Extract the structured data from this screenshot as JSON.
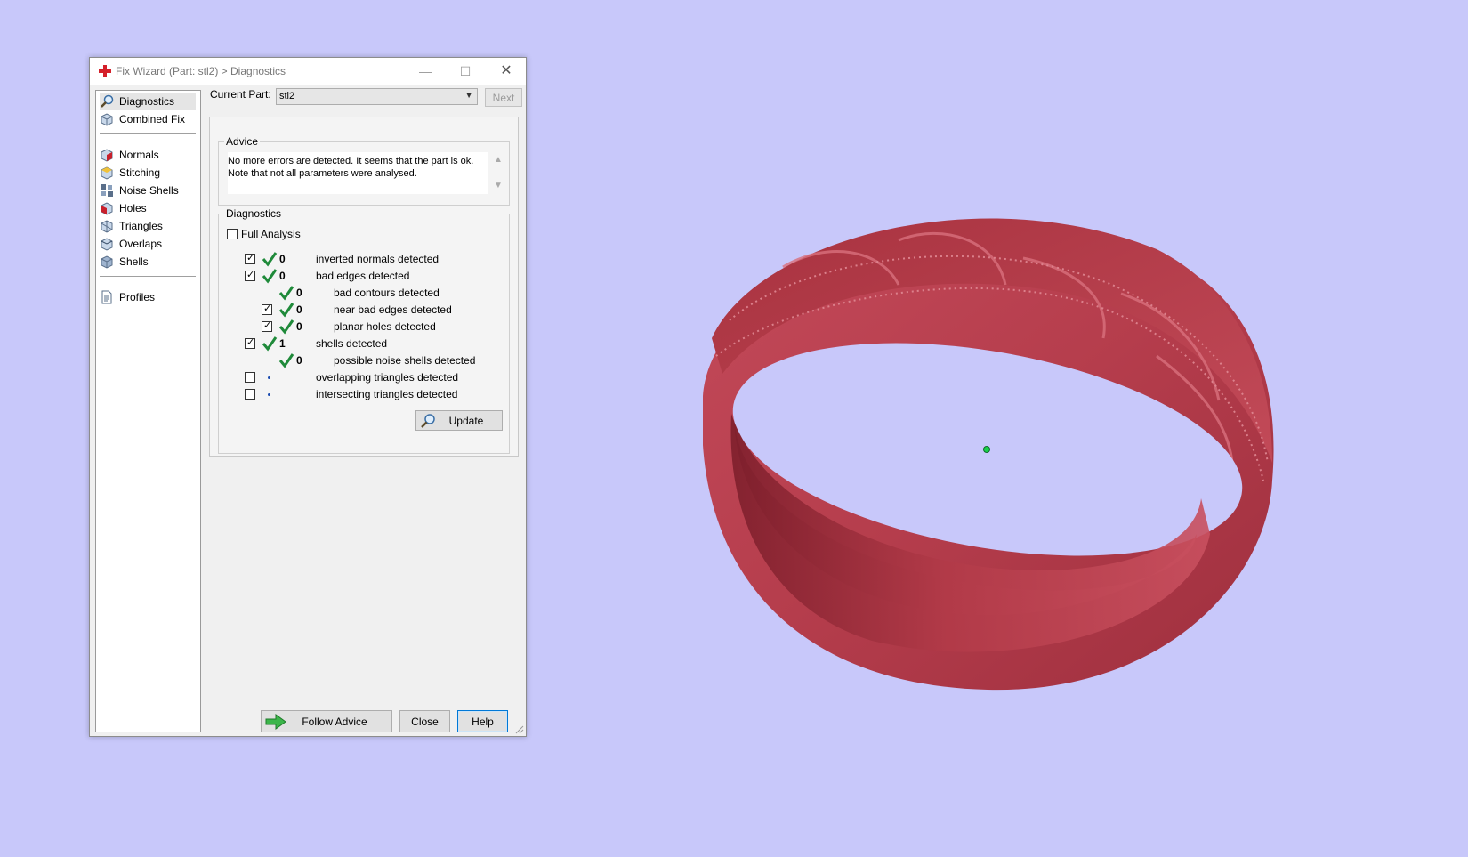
{
  "window": {
    "title": "Fix Wizard (Part: stl2) > Diagnostics",
    "minimize": "—",
    "maximize": "☐",
    "close": "✕"
  },
  "sidebar": {
    "items_top": [
      {
        "label": "Diagnostics",
        "icon": "magnifier-icon",
        "active": true
      },
      {
        "label": "Combined Fix",
        "icon": "cube-icon",
        "active": false
      }
    ],
    "items_mid": [
      {
        "label": "Normals",
        "icon": "normals-cube-icon"
      },
      {
        "label": "Stitching",
        "icon": "stitching-cube-icon"
      },
      {
        "label": "Noise Shells",
        "icon": "noise-shells-icon"
      },
      {
        "label": "Holes",
        "icon": "holes-cube-icon"
      },
      {
        "label": "Triangles",
        "icon": "triangles-cube-icon"
      },
      {
        "label": "Overlaps",
        "icon": "overlaps-cube-icon"
      },
      {
        "label": "Shells",
        "icon": "shells-cube-icon"
      }
    ],
    "items_bottom": [
      {
        "label": "Profiles",
        "icon": "document-icon"
      }
    ]
  },
  "current_part": {
    "label": "Current Part:",
    "value": "stl2",
    "next_label": "Next"
  },
  "advice": {
    "title": "Advice",
    "lines": [
      "No more errors are detected. It seems that the part is ok.",
      "Note that not all parameters were analysed."
    ]
  },
  "diagnostics": {
    "title": "Diagnostics",
    "full_analysis_label": "Full Analysis",
    "full_analysis_checked": false,
    "rows": [
      {
        "checkbox": true,
        "checked": true,
        "status": "ok",
        "value": "0",
        "text": "inverted normals detected",
        "indent": 0
      },
      {
        "checkbox": true,
        "checked": true,
        "status": "ok",
        "value": "0",
        "text": "bad edges detected",
        "indent": 0
      },
      {
        "checkbox": false,
        "checked": false,
        "status": "ok",
        "value": "0",
        "text": "bad contours detected",
        "indent": 1
      },
      {
        "checkbox": true,
        "checked": true,
        "status": "ok",
        "value": "0",
        "text": "near bad edges detected",
        "indent": 1
      },
      {
        "checkbox": true,
        "checked": true,
        "status": "ok",
        "value": "0",
        "text": "planar holes detected",
        "indent": 1
      },
      {
        "checkbox": true,
        "checked": true,
        "status": "ok",
        "value": "1",
        "text": "shells detected",
        "indent": 0
      },
      {
        "checkbox": false,
        "checked": false,
        "status": "ok",
        "value": "0",
        "text": "possible noise shells detected",
        "indent": 1
      },
      {
        "checkbox": true,
        "checked": false,
        "status": "pending",
        "value": "",
        "text": "overlapping triangles detected",
        "indent": 0
      },
      {
        "checkbox": true,
        "checked": false,
        "status": "pending",
        "value": "",
        "text": "intersecting triangles detected",
        "indent": 0
      }
    ],
    "update_label": "Update"
  },
  "footer": {
    "follow_advice_label": "Follow Advice",
    "close_label": "Close",
    "help_label": "Help"
  },
  "colors": {
    "background": "#c8c8fa",
    "ring": "#b23a48",
    "check_green": "#1f8a3a"
  }
}
